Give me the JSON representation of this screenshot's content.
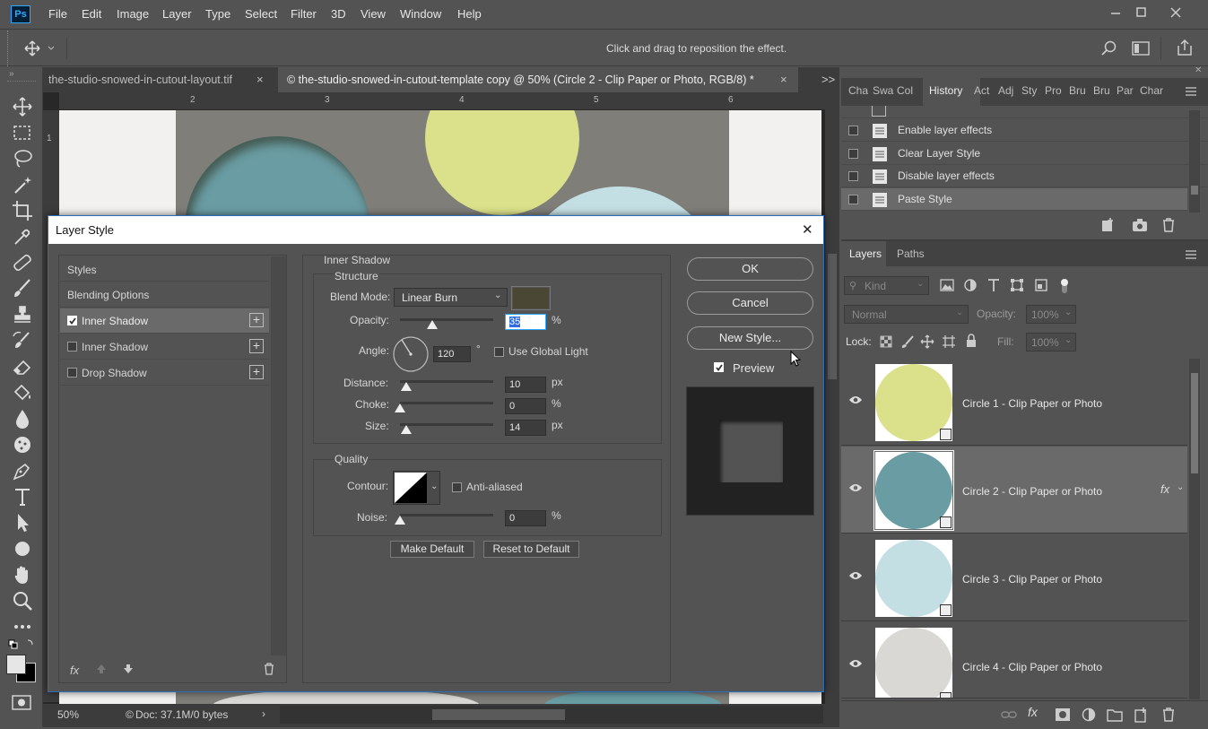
{
  "app": {
    "logo": "Ps"
  },
  "menu": [
    "File",
    "Edit",
    "Image",
    "Layer",
    "Type",
    "Select",
    "Filter",
    "3D",
    "View",
    "Window",
    "Help"
  ],
  "options_bar": {
    "hint": "Click and drag to reposition the effect."
  },
  "doc_tabs": [
    {
      "label": "the-studio-snowed-in-cutout-layout.tif",
      "close": "×"
    },
    {
      "label": "© the-studio-snowed-in-cutout-template copy @ 50% (Circle 2 - Clip Paper or Photo, RGB/8) *",
      "close": "×"
    }
  ],
  "tabs_overflow": ">>",
  "rulers": {
    "top": [
      "2",
      "3",
      "4",
      "5",
      "6"
    ],
    "left": [
      "1"
    ]
  },
  "status": {
    "zoom": "50%",
    "doc": "Doc: 37.1M/0 bytes",
    "arrow": "›"
  },
  "history_panel": {
    "tabs": [
      "Cha",
      "Swa",
      "Col",
      "History",
      "Act",
      "Adj",
      "Sty",
      "Pro",
      "Bru",
      "Bru",
      "Par",
      "Char"
    ],
    "active_tab": "History",
    "items": [
      "Enable layer effects",
      "Clear Layer Style",
      "Disable layer effects",
      "Paste Style"
    ]
  },
  "layers_panel": {
    "tabs": [
      "Layers",
      "Paths"
    ],
    "filter_kind": "Kind",
    "blend_mode": "Normal",
    "opacity_label": "Opacity:",
    "opacity_value": "100%",
    "lock_label": "Lock:",
    "fill_label": "Fill:",
    "fill_value": "100%",
    "layers": [
      {
        "name": "Circle 1 - Clip Paper or Photo",
        "color": "#dbe08a",
        "selected": false,
        "fx": ""
      },
      {
        "name": "Circle 2 - Clip Paper or Photo",
        "color": "#6a9ca3",
        "selected": true,
        "fx": "fx"
      },
      {
        "name": "Circle 3 - Clip Paper or Photo",
        "color": "#c3dfe4",
        "selected": false,
        "fx": ""
      },
      {
        "name": "Circle 4 - Clip Paper or Photo",
        "color": "#d9d8d4",
        "selected": false,
        "fx": ""
      }
    ]
  },
  "dialog": {
    "title": "Layer Style",
    "close": "✕",
    "styles_list": {
      "styles": "Styles",
      "blending": "Blending Options",
      "items": [
        {
          "label": "Inner Shadow",
          "checked": true
        },
        {
          "label": "Inner Shadow",
          "checked": false
        },
        {
          "label": "Drop Shadow",
          "checked": false
        }
      ],
      "plus": "+"
    },
    "section_title": "Inner Shadow",
    "structure": {
      "title": "Structure",
      "blend_mode_label": "Blend Mode:",
      "blend_mode_value": "Linear Burn",
      "shadow_color": "#4a4835",
      "opacity_label": "Opacity:",
      "opacity_value": "35",
      "opacity_unit": "%",
      "angle_label": "Angle:",
      "angle_value": "120",
      "angle_unit": "°",
      "global_light": "Use Global Light",
      "distance_label": "Distance:",
      "distance_value": "10",
      "distance_unit": "px",
      "choke_label": "Choke:",
      "choke_value": "0",
      "choke_unit": "%",
      "size_label": "Size:",
      "size_value": "14",
      "size_unit": "px"
    },
    "quality": {
      "title": "Quality",
      "contour_label": "Contour:",
      "anti_aliased": "Anti-aliased",
      "noise_label": "Noise:",
      "noise_value": "0",
      "noise_unit": "%"
    },
    "make_default": "Make Default",
    "reset_default": "Reset to Default",
    "buttons": {
      "ok": "OK",
      "cancel": "Cancel",
      "new_style": "New Style...",
      "preview": "Preview"
    },
    "slider_levels": {
      "opacity": 0.35,
      "distance": 0.07,
      "choke": 0.0,
      "size": 0.07,
      "noise": 0.0
    }
  },
  "canvas_colors": {
    "gray": "#7f7e79",
    "yellow": "#dbe08a",
    "teal": "#6a9ca3",
    "lightblue": "#c3dfe4",
    "paper": "#f2f1ef"
  }
}
